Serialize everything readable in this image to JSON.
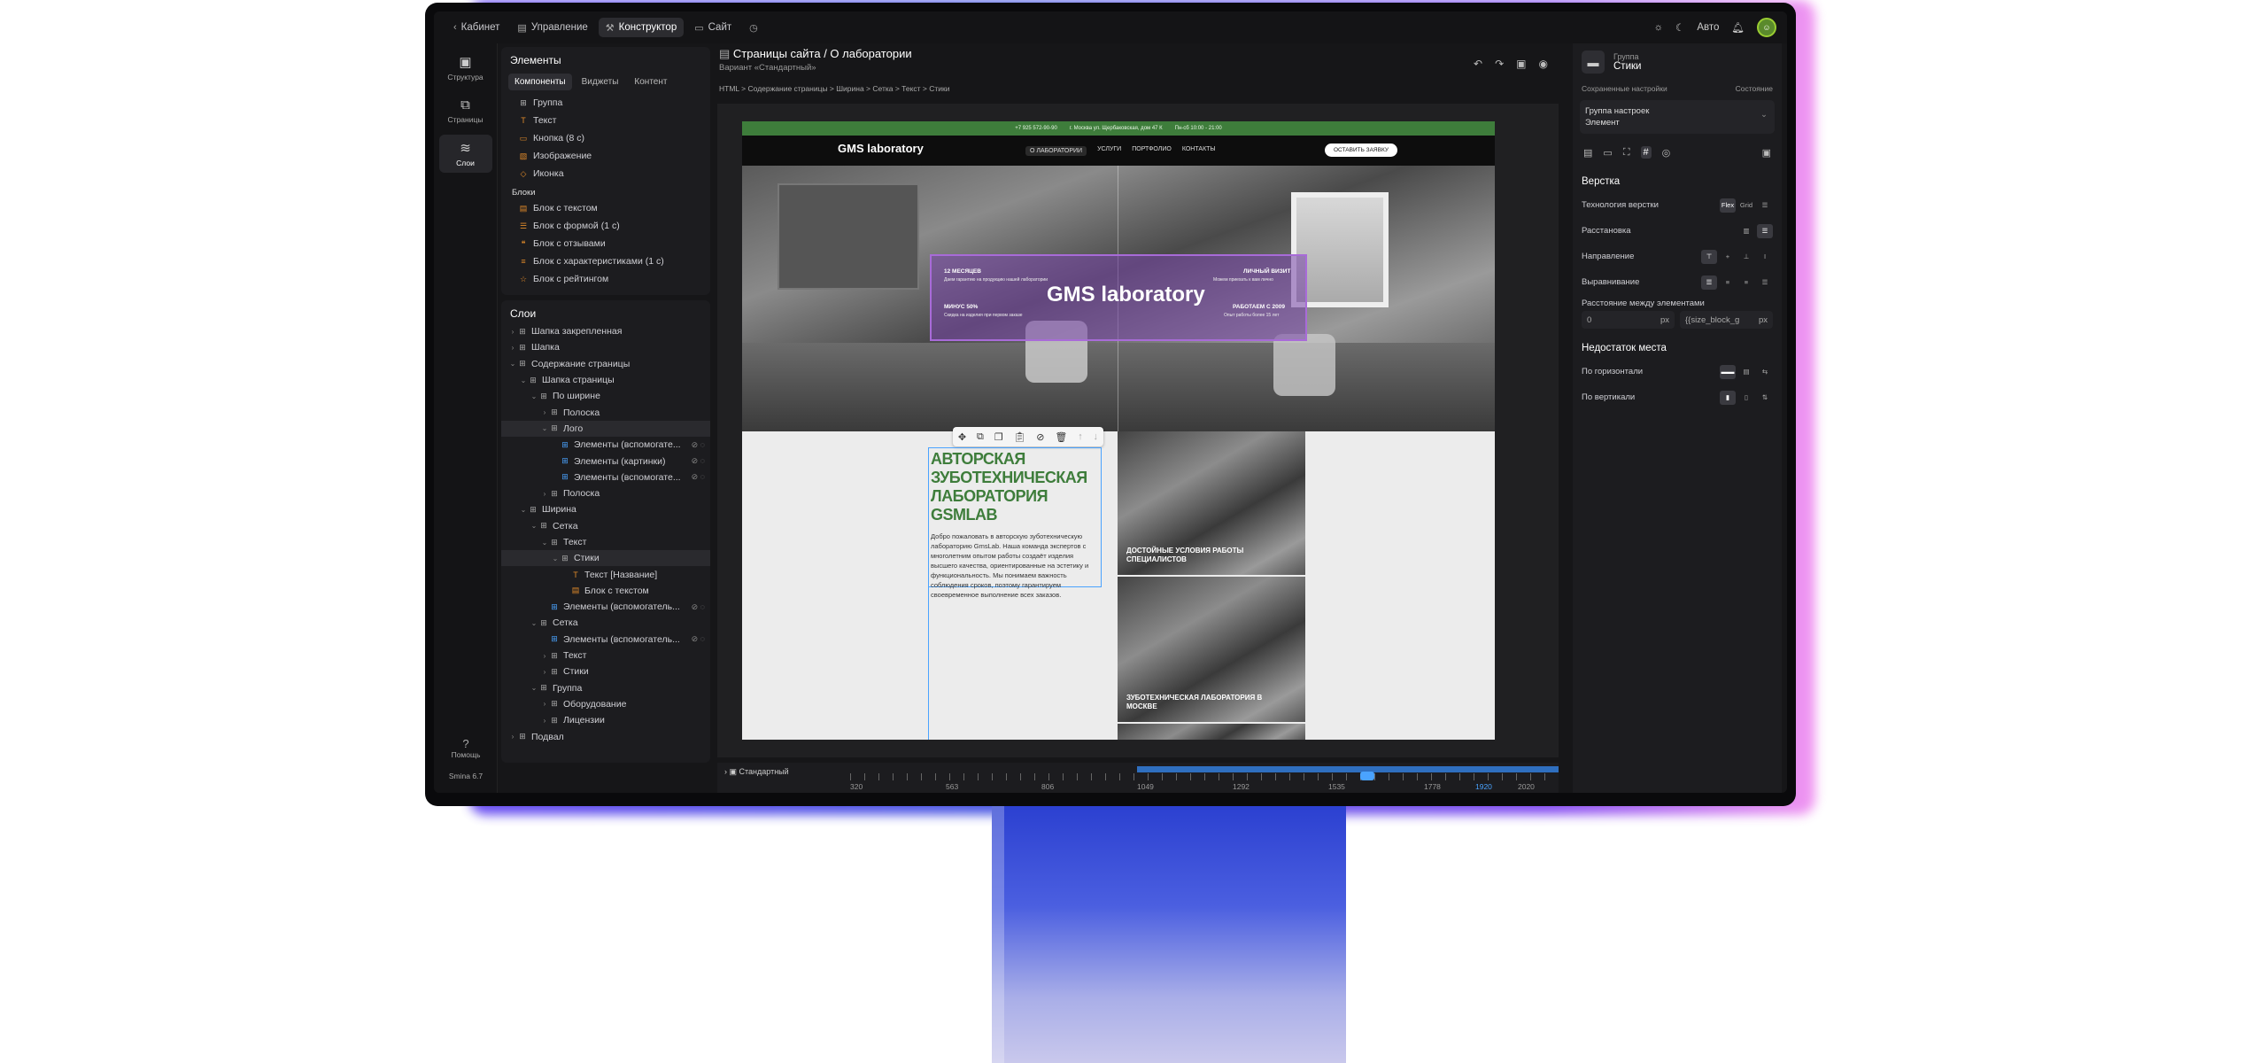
{
  "topbar": {
    "items": [
      "Кабинет",
      "Управление",
      "Конструктор",
      "Сайт"
    ],
    "auto": "Авто"
  },
  "rail": {
    "items": [
      "Структура",
      "Страницы",
      "Слои"
    ],
    "help": "Помощь",
    "version": "Smina 6.7"
  },
  "elements": {
    "title": "Элементы",
    "tabs": [
      "Компоненты",
      "Виджеты",
      "Контент"
    ],
    "components": [
      "Группа",
      "Текст",
      "Кнопка (8 с)",
      "Изображение",
      "Иконка"
    ],
    "blocks_title": "Блоки",
    "blocks": [
      "Блок с текстом",
      "Блок с формой (1 с)",
      "Блок с отзывами",
      "Блок с характеристиками (1 с)",
      "Блок с рейтингом"
    ]
  },
  "layers": {
    "title": "Слои",
    "items": [
      {
        "label": "Шапка закрепленная"
      },
      {
        "label": "Шапка"
      },
      {
        "label": "Содержание страницы"
      },
      {
        "label": "Шапка страницы"
      },
      {
        "label": "По ширине"
      },
      {
        "label": "Полоска"
      },
      {
        "label": "Лого"
      },
      {
        "label": "Элементы (вспомогате..."
      },
      {
        "label": "Элементы (картинки)"
      },
      {
        "label": "Элементы (вспомогате..."
      },
      {
        "label": "Полоска"
      },
      {
        "label": "Ширина"
      },
      {
        "label": "Сетка"
      },
      {
        "label": "Текст"
      },
      {
        "label": "Стики"
      },
      {
        "label": "Текст [Название]"
      },
      {
        "label": "Блок с текстом"
      },
      {
        "label": "Элементы (вспомогатель..."
      },
      {
        "label": "Сетка"
      },
      {
        "label": "Элементы (вспомогатель..."
      },
      {
        "label": "Текст"
      },
      {
        "label": "Стики"
      },
      {
        "label": "Группа"
      },
      {
        "label": "Оборудование"
      },
      {
        "label": "Лицензии"
      },
      {
        "label": "Подвал"
      }
    ]
  },
  "canvas": {
    "title": "Страницы сайта / О лаборатории",
    "variant": "Вариант «Стандартный»",
    "breadcrumbs": "HTML  >  Содержание страницы  >  Ширина  >  Сетка  >  Текст  >  Стики"
  },
  "site": {
    "phone": "+7 925 572-90-90",
    "address": "г. Москва ул. Щербаковская, дом 47 К",
    "hours": "Пн-сб 10:00 - 21:00",
    "logo": "GMS laboratory",
    "menu": [
      "О ЛАБОРАТОРИИ",
      "УСЛУГИ",
      "ПОРТФОЛИО",
      "КОНТАКТЫ"
    ],
    "cta": "ОСТАВИТЬ ЗАЯВКУ",
    "overlay": {
      "t1": "12 МЕСЯЦЕВ",
      "s1": "Даем гарантию на продукцию нашей лаборатории",
      "t2": "МИНУС 50%",
      "s2": "Скидка на изделия при первом заказе",
      "t3": "ЛИЧНЫЙ ВИЗИТ",
      "s3": "Можем приехать к вам лично",
      "t4": "РАБОТАЕМ С 2009",
      "s4": "Опыт работы более 15 лет"
    },
    "heading": "АВТОРСКАЯ ЗУБОТЕХНИЧЕСКАЯ ЛАБОРАТОРИЯ GSMLAB",
    "paragraph": "Добро пожаловать в авторскую зуботехническую лабораторию GmsLab. Наша команда экспертов с многолетним опытом работы создаёт изделия высшего качества, ориентированные на эстетику и функциональность. Мы понимаем важность соблюдения сроков, поэтому гарантируем своевременное выполнение всех заказов.",
    "cap1": "ДОСТОЙНЫЕ УСЛОВИЯ РАБОТЫ СПЕЦИАЛИСТОВ",
    "cap2": "ЗУБОТЕХНИЧЕСКАЯ ЛАБОРАТОРИЯ В МОСКВЕ"
  },
  "timeline": {
    "label": "Стандартный",
    "ticks": [
      "320",
      "563",
      "806",
      "1049",
      "1292",
      "1535",
      "1778",
      "1920",
      "2020"
    ],
    "active": "1920"
  },
  "right": {
    "type": "Группа",
    "name": "Стики",
    "saved": "Сохраненные настройки",
    "state": "Состояние",
    "group_title": "Группа настроек",
    "group_value": "Элемент",
    "layout_title": "Верстка",
    "tech": "Технология верстки",
    "tech_opts": [
      "Flex",
      "Grid"
    ],
    "arrange": "Расстановка",
    "direction": "Направление",
    "align": "Выравнивание",
    "gap": "Расстояние между элементами",
    "gap_value": "0",
    "gap_unit": "px",
    "gap_var": "{{size_block_g",
    "lack_title": "Недостаток места",
    "horiz": "По горизонтали",
    "vert": "По вертикали"
  }
}
